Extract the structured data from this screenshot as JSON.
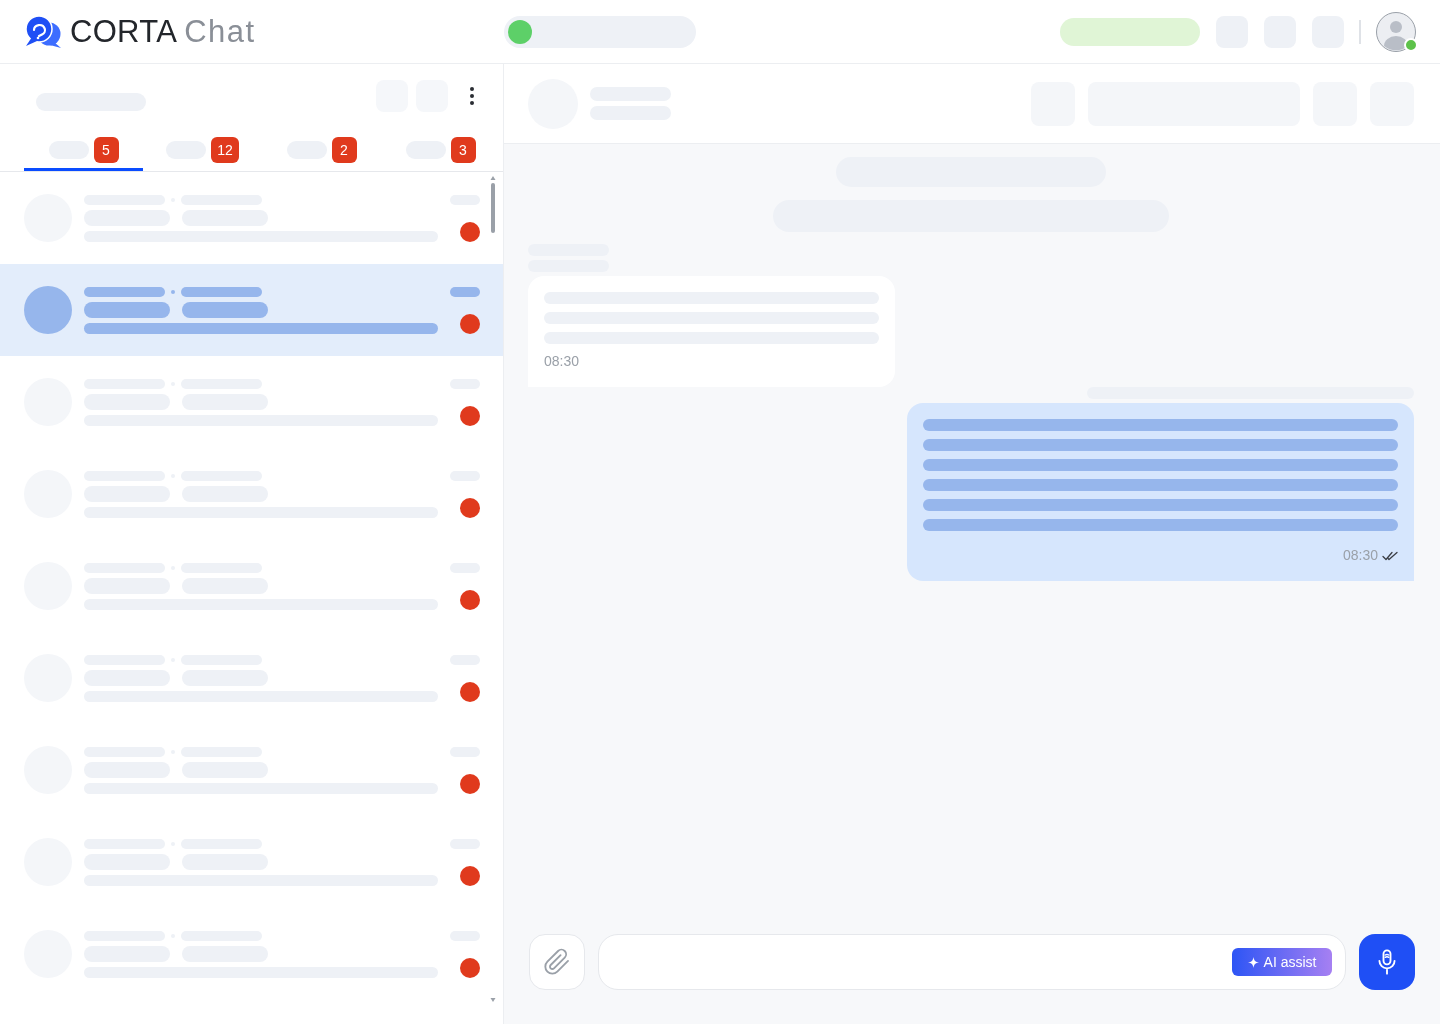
{
  "header": {
    "logo": {
      "brand": "CORTA",
      "product": "Chat"
    },
    "status": {
      "online": true
    },
    "avatar": {
      "online": true
    }
  },
  "sidebar": {
    "tabs": [
      {
        "badge": "5",
        "selected": true
      },
      {
        "badge": "12",
        "selected": false
      },
      {
        "badge": "2",
        "selected": false
      },
      {
        "badge": "3",
        "selected": false
      }
    ],
    "conversations": [
      {
        "selected": false,
        "unread": true
      },
      {
        "selected": true,
        "unread": true
      },
      {
        "selected": false,
        "unread": true
      },
      {
        "selected": false,
        "unread": true
      },
      {
        "selected": false,
        "unread": true
      },
      {
        "selected": false,
        "unread": true
      },
      {
        "selected": false,
        "unread": true
      },
      {
        "selected": false,
        "unread": true
      },
      {
        "selected": false,
        "unread": true
      }
    ]
  },
  "chat": {
    "messages": [
      {
        "kind": "incoming",
        "time": "08:30"
      },
      {
        "kind": "outgoing",
        "time": "08:30",
        "read": true
      }
    ],
    "composer": {
      "ai_assist": "AI assist"
    }
  }
}
